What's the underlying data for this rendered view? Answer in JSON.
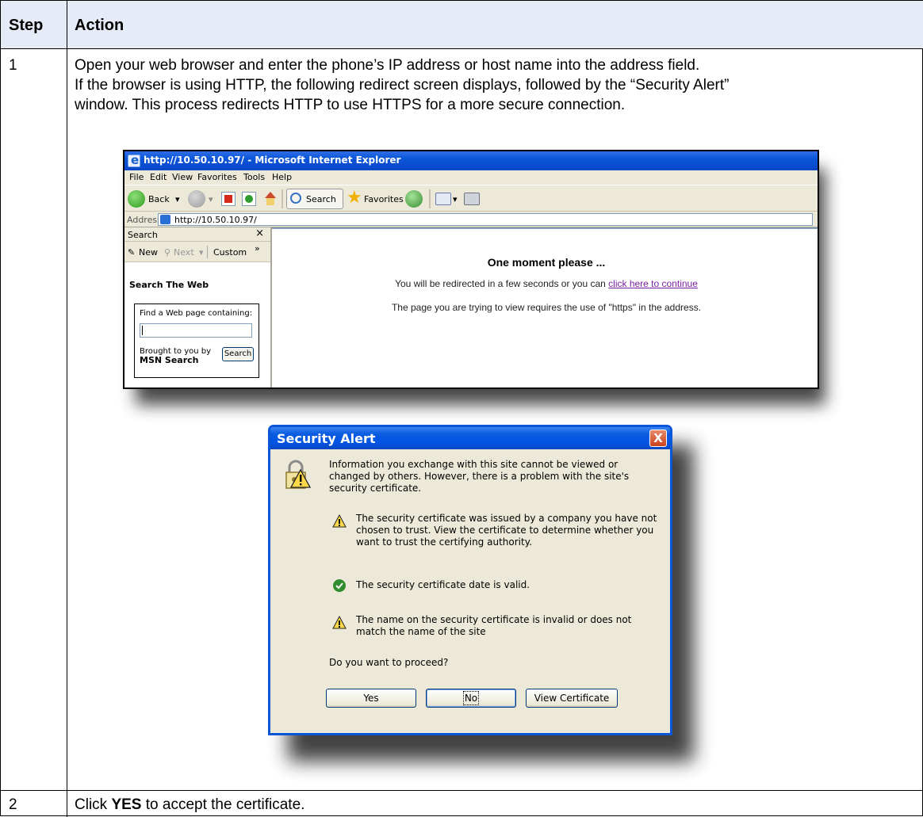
{
  "table": {
    "header_step": "Step",
    "header_action": "Action",
    "row1_step": "1",
    "row1_lines": [
      "Open your web browser and enter the phone’s IP address or host name into the address field.",
      "If the browser is using HTTP, the following redirect screen displays, followed by the “Security Alert”",
      "window. This process redirects HTTP to use HTTPS for a more secure connection."
    ],
    "row2_step": "2",
    "row2_prefix": "Click ",
    "row2_bold": "YES",
    "row2_suffix": " to accept the certificate."
  },
  "browser": {
    "title": "http://10.50.10.97/ - Microsoft Internet Explorer",
    "menu": [
      "File",
      "Edit",
      "View",
      "Favorites",
      "Tools",
      "Help"
    ],
    "toolbar": {
      "back": "Back",
      "search": "Search",
      "favorites": "Favorites"
    },
    "address_label": "Address",
    "address_value": "http://10.50.10.97/",
    "search_pane": {
      "title": "Search",
      "close": "×",
      "new": "New",
      "next": "Next",
      "custom": "Custom",
      "more": "»",
      "heading": "Search The Web",
      "find_label": "Find a Web page containing:",
      "brought": "Brought to you by",
      "msn": "MSN Search",
      "button": "Search"
    },
    "content": {
      "heading": "One moment please ...",
      "line1_prefix": "You will be redirected in a few seconds or you can ",
      "line1_link": "click here to continue",
      "line2": "The page you are trying to view requires the use of \"https\" in the address."
    }
  },
  "dialog": {
    "title": "Security Alert",
    "close": "X",
    "intro": "Information you exchange with this site cannot be viewed or changed by others. However, there is a problem with the site's security certificate.",
    "items": [
      {
        "icon": "warning-icon",
        "text": "The security certificate was issued by a company you have not chosen to trust. View the certificate to determine whether you want to trust the certifying authority."
      },
      {
        "icon": "check-icon",
        "text": "The security certificate date is valid."
      },
      {
        "icon": "warning-icon",
        "text": "The name on the security certificate is invalid or does not match the name of the site"
      }
    ],
    "question": "Do you want to proceed?",
    "buttons": {
      "yes": "Yes",
      "no": "No",
      "view": "View Certificate"
    }
  }
}
